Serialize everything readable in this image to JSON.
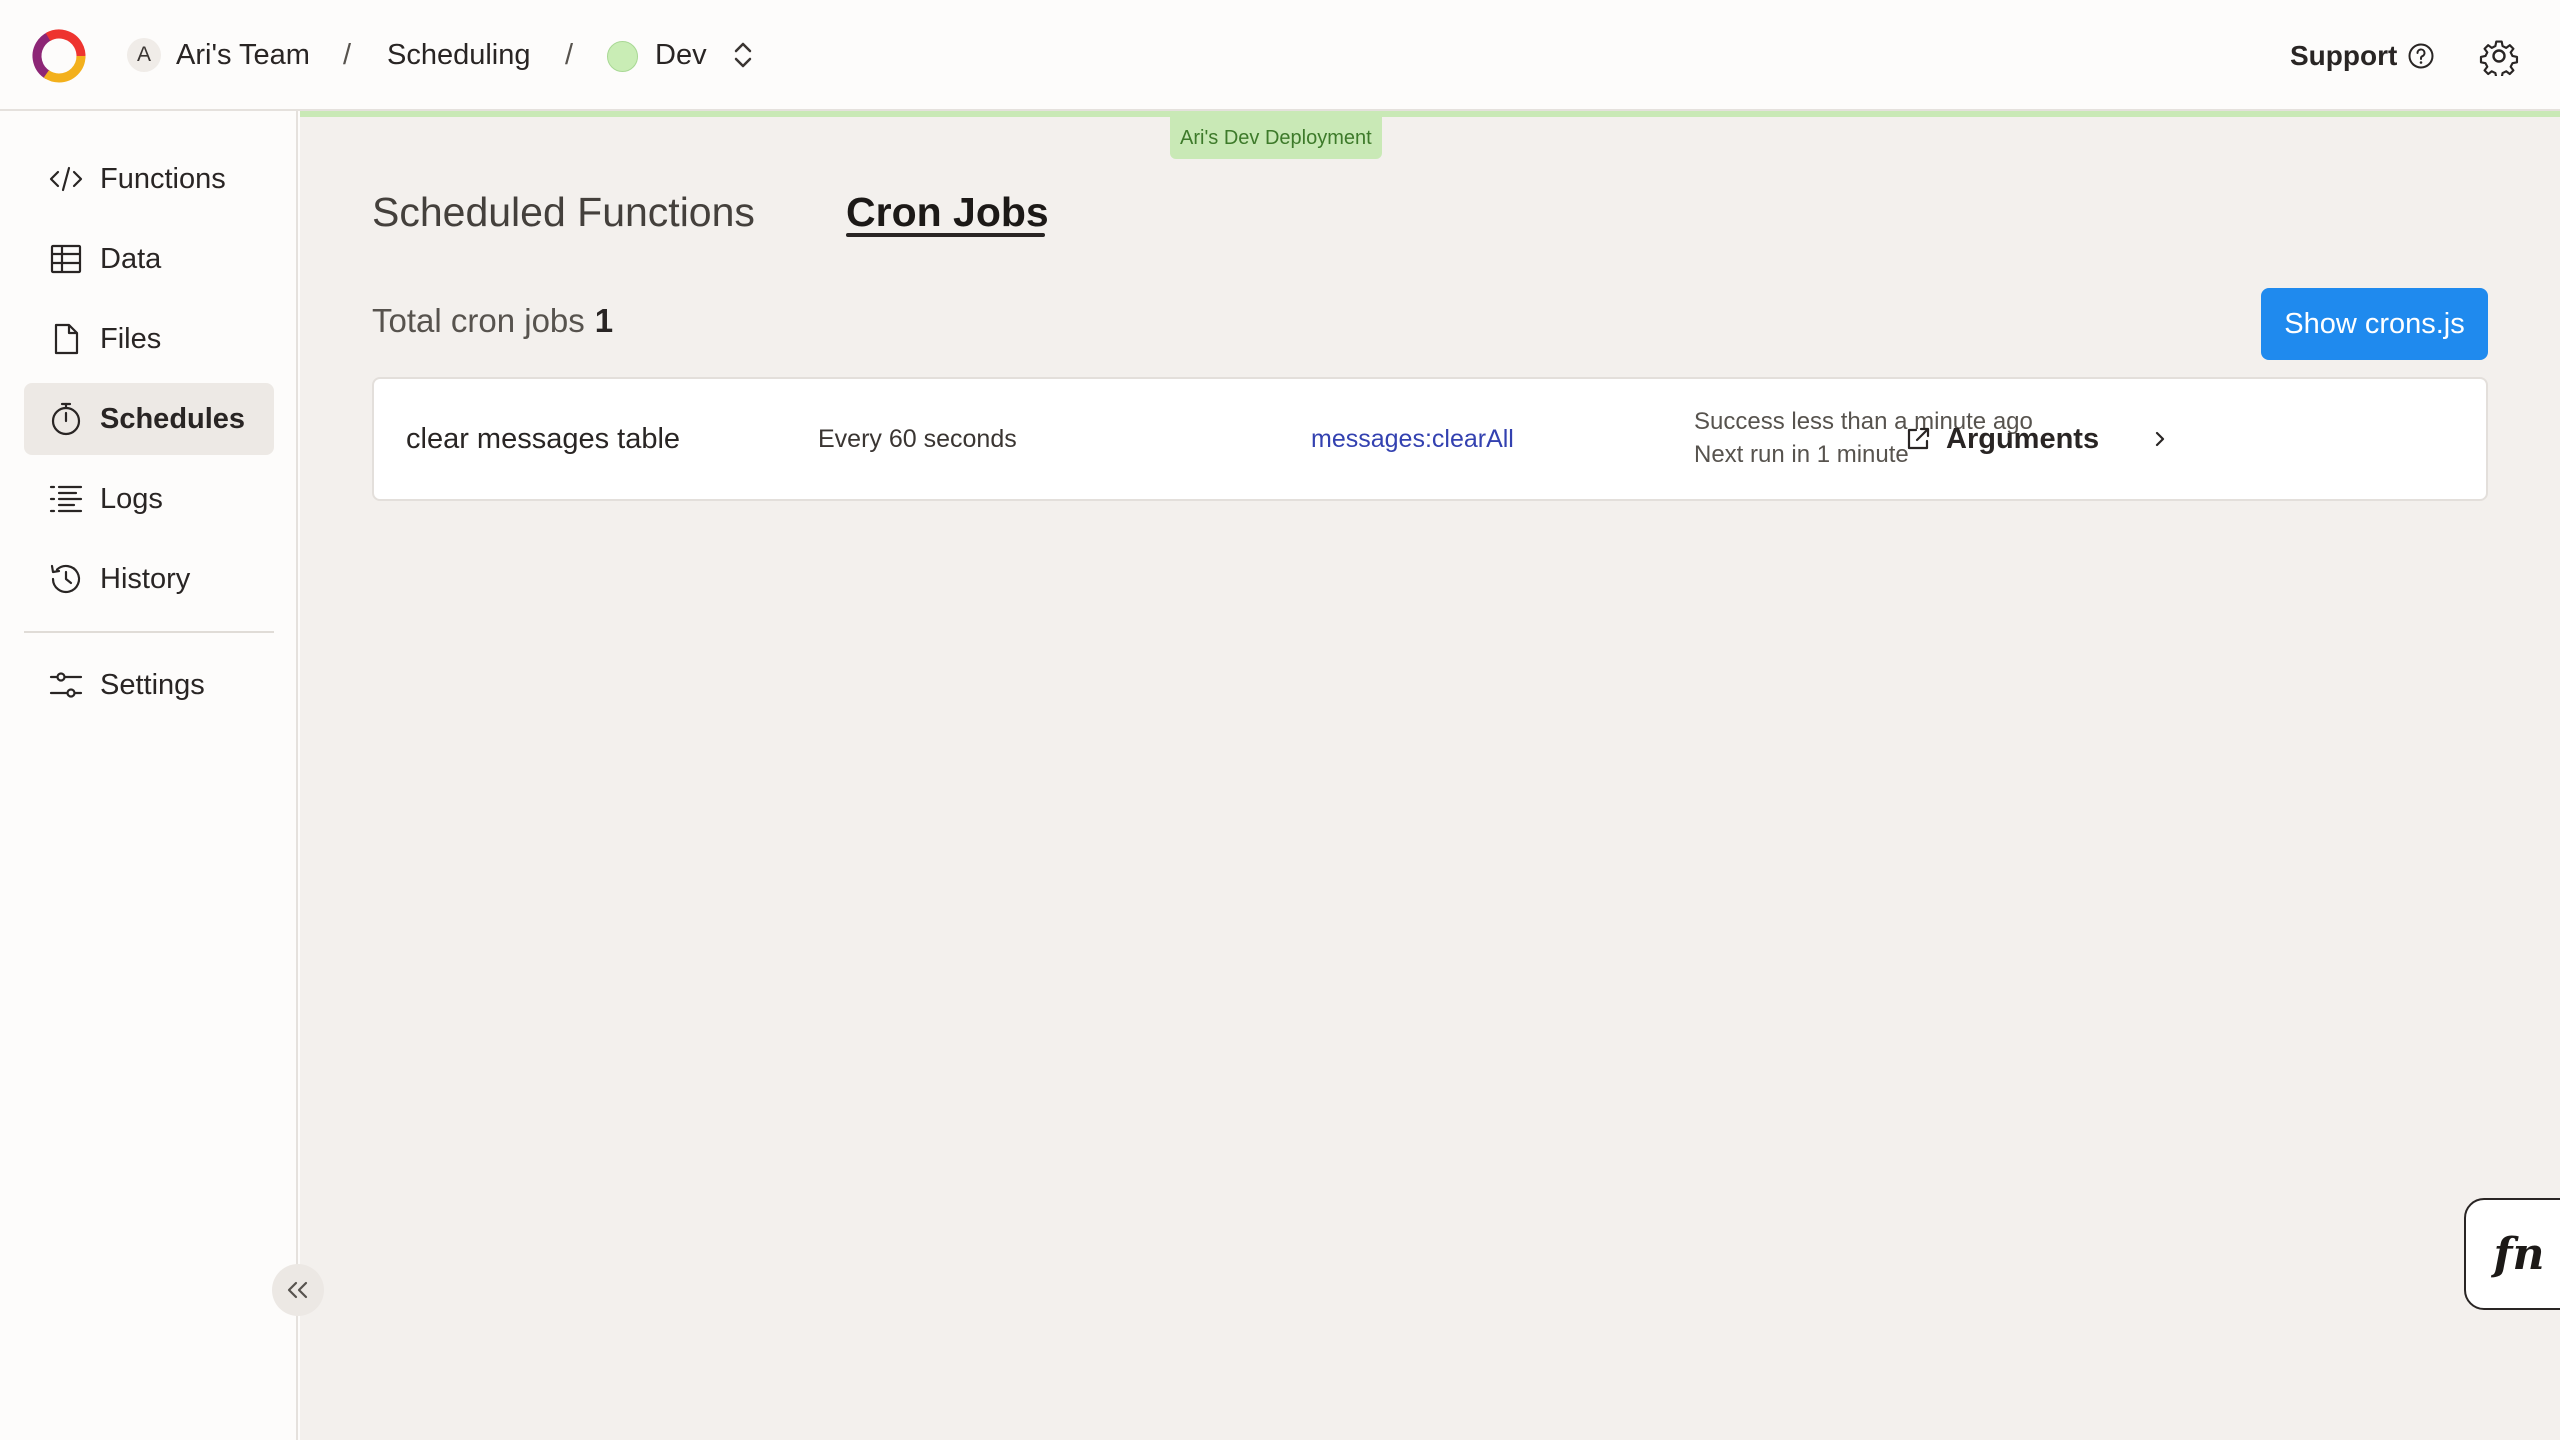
{
  "header": {
    "team_initial": "A",
    "team_name": "Ari's Team",
    "project_name": "Scheduling",
    "deployment_name": "Dev",
    "separator": "/",
    "support_label": "Support"
  },
  "sidebar": {
    "items": [
      {
        "label": "Functions",
        "icon": "code-icon"
      },
      {
        "label": "Data",
        "icon": "table-icon"
      },
      {
        "label": "Files",
        "icon": "file-icon"
      },
      {
        "label": "Schedules",
        "icon": "stopwatch-icon",
        "active": true
      },
      {
        "label": "Logs",
        "icon": "logs-icon"
      },
      {
        "label": "History",
        "icon": "history-icon"
      },
      {
        "label": "Settings",
        "icon": "sliders-icon"
      }
    ]
  },
  "main": {
    "deployment_tag": "Ari's Dev Deployment",
    "tabs": [
      {
        "label": "Scheduled Functions",
        "active": false
      },
      {
        "label": "Cron Jobs",
        "active": true
      }
    ],
    "total_label": "Total cron jobs",
    "total_count": "1",
    "show_button_label": "Show crons.js",
    "cron_jobs": [
      {
        "name": "clear messages table",
        "schedule": "Every 60 seconds",
        "function": "messages:clearAll",
        "status_line": "Success less than a minute ago",
        "next_run": "Next run in 1 minute",
        "arguments_label": "Arguments"
      }
    ]
  },
  "fn_button_label": "fn",
  "colors": {
    "accent": "#1f8aee",
    "deployment": "#c9e9b6",
    "function_link": "#3341b0"
  }
}
